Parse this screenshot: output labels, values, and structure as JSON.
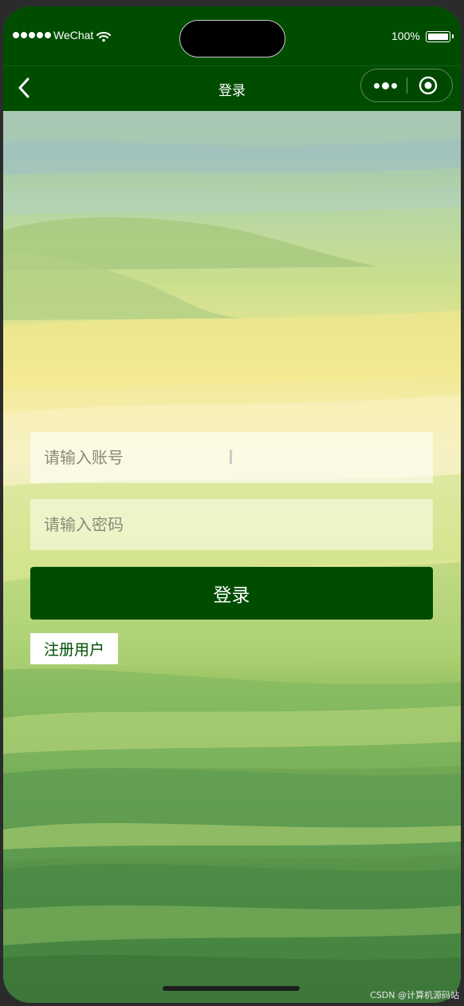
{
  "status_bar": {
    "carrier": "WeChat",
    "battery_percent": "100%",
    "signal_icon": "signal-dots-icon",
    "wifi_icon": "wifi-icon",
    "battery_icon": "battery-icon"
  },
  "nav": {
    "title": "登录",
    "back_icon": "chevron-left-icon",
    "more_icon": "more-dots-icon",
    "close_icon": "capsule-close-icon"
  },
  "form": {
    "account_placeholder": "请输入账号",
    "password_placeholder": "请输入密码",
    "login_label": "登录",
    "register_label": "注册用户"
  },
  "watermark": "CSDN @计算机源码站",
  "colors": {
    "primary": "#004d00",
    "nav_text": "#ffffff",
    "register_text": "#004d00"
  }
}
